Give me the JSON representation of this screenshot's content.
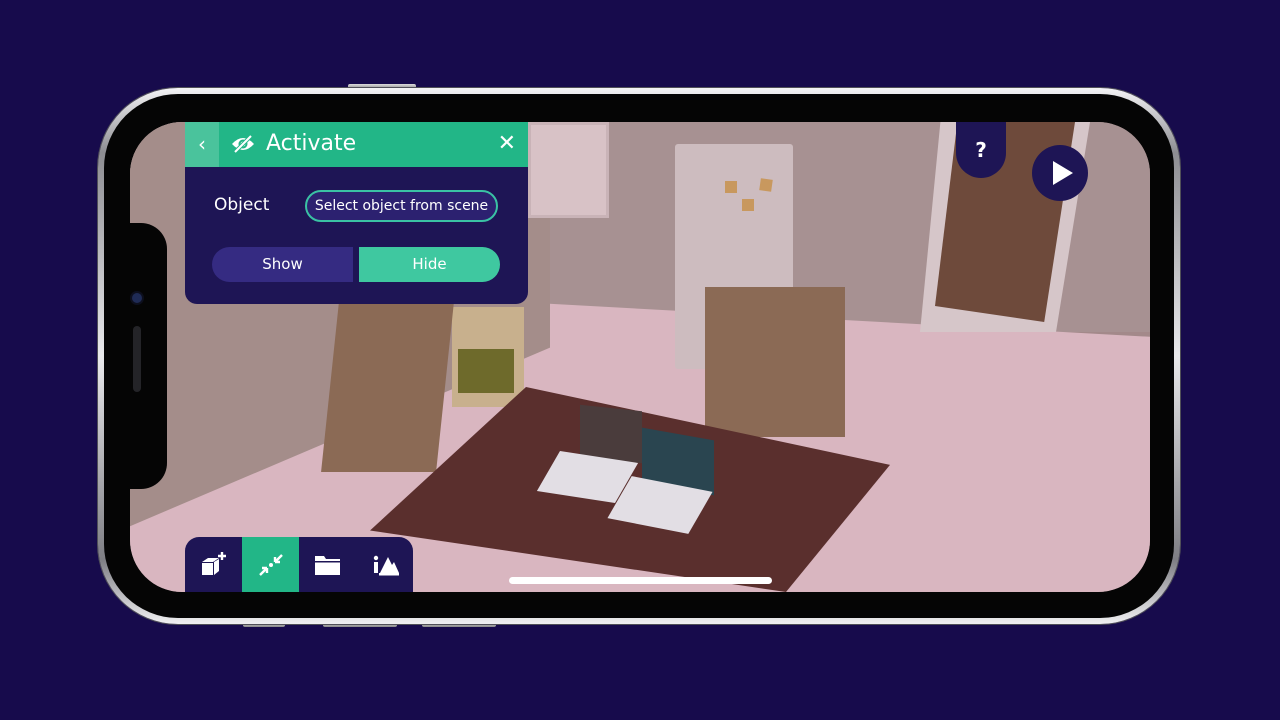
{
  "panel": {
    "title": "Activate",
    "back_icon": "chevron-left-icon",
    "title_icon": "eye-slash-icon",
    "close_icon": "close-icon",
    "object_label": "Object",
    "select_button": "Select object from scene",
    "toggle": {
      "options": [
        {
          "label": "Show",
          "selected": false
        },
        {
          "label": "Hide",
          "selected": true
        }
      ]
    }
  },
  "top_buttons": {
    "help_label": "?",
    "play_icon": "play-icon"
  },
  "toolbar": {
    "items": [
      {
        "icon": "add-object-icon",
        "active": false
      },
      {
        "icon": "compress-icon",
        "active": true
      },
      {
        "icon": "folder-icon",
        "active": false
      },
      {
        "icon": "scene-settings-icon",
        "active": false
      }
    ]
  },
  "colors": {
    "background": "#170b4c",
    "panel": "#1e1555",
    "accent": "#22b687",
    "accent_light": "#3fc8a0",
    "toggle_inactive": "#352b82"
  }
}
